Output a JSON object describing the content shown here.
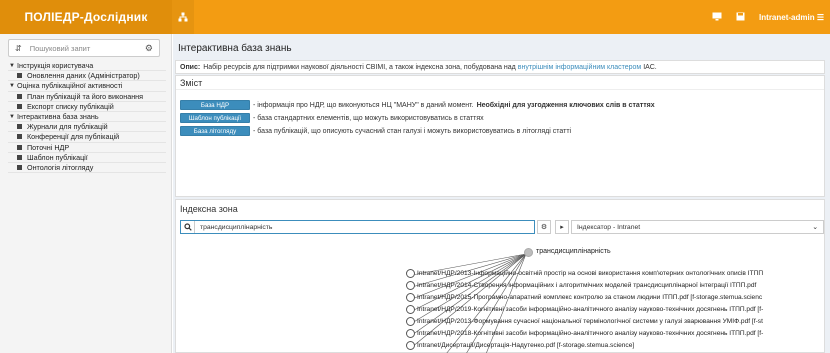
{
  "header": {
    "brand": "ПОЛІЕДР-Дослідник",
    "toggle_icon": "sitemap-icon",
    "user_label": "Intranet-admin ☰"
  },
  "sidebar": {
    "search_placeholder": "Пошуковий запит",
    "tree": [
      {
        "label": "Інструкція користувача",
        "level": 0
      },
      {
        "label": "Оновлення даних (Адміністратор)",
        "level": 1
      },
      {
        "label": "Оцінка публікаційної активності",
        "level": 0
      },
      {
        "label": "План публікацій та його виконання",
        "level": 1
      },
      {
        "label": "Експорт списку публікацій",
        "level": 1
      },
      {
        "label": "Інтерактивна база знань",
        "level": 0
      },
      {
        "label": "Журнали для публікацій",
        "level": 1
      },
      {
        "label": "Конференції для публікацій",
        "level": 1
      },
      {
        "label": "Поточні НДР",
        "level": 1
      },
      {
        "label": "Шаблон публікації",
        "level": 1
      },
      {
        "label": "Онтологія літогляду",
        "level": 1
      }
    ]
  },
  "main": {
    "title": "Інтерактивна база знань",
    "desc_label": "Опис:",
    "desc_text": "Набір ресурсів для підтримки наукової діяльності СВІМІ, а також індексна зона, побудована над",
    "desc_link": "внутрішнім інформаційним кластером",
    "desc_tail": "ІАС.",
    "content_header": "Зміст",
    "content_rows": [
      {
        "button": "База НДР",
        "pre": "- інформація про НДР, що виконуються НЦ \"МАНУ\" в даний момент.",
        "bold": "Необхідні для узгодження ключових слів в статтях"
      },
      {
        "button": "Шаблон публікації",
        "pre": "- база стандартних елементів, що можуть використовуватись в статтях",
        "bold": ""
      },
      {
        "button": "База літогляду",
        "pre": "- база публікацій, що описують сучасний стан галузі і можуть використовуватись в літогляді статті",
        "bold": ""
      }
    ],
    "index_header": "Індексна зона",
    "index_query": "трансдисциплінарність",
    "index_selector": "Індексатор - Intranet",
    "graph_root": "трансдисциплінарність",
    "graph_leaves": [
      "Intranet/НДР/2013-Інформаційно-освітній простір на основі використання комп'ютерних онтологічних описів ІТПП",
      "Intranet/НДР/2014-Створення інформаційних і алгоритмічних моделей трансдисциплінарної інтеграції ІТПП.pdf",
      "Intranet/НДР/2015-Програмно-апаратний комплекс контролю за станом людини ІТПП.pdf [f-storage.stemua.scienc",
      "Intranet/НДР/2019-Когнітивні засоби інформаційно-аналітичного аналізу науково-технічних досягнень ІТПП.pdf [f-",
      "Intranet/НДР/2013-Формування сучасної національної термінологічної системи у галузі зварювання УМІФ.pdf [f-st",
      "Intranet/НДР/2018-Когнітивні засоби інформаційно-аналітичного аналізу науково-технічних досягнень ІТПП.pdf [f-",
      "Intranet/Дисертації/Дисертація-Надутенко.pdf [f-storage.stemua.science]"
    ]
  }
}
